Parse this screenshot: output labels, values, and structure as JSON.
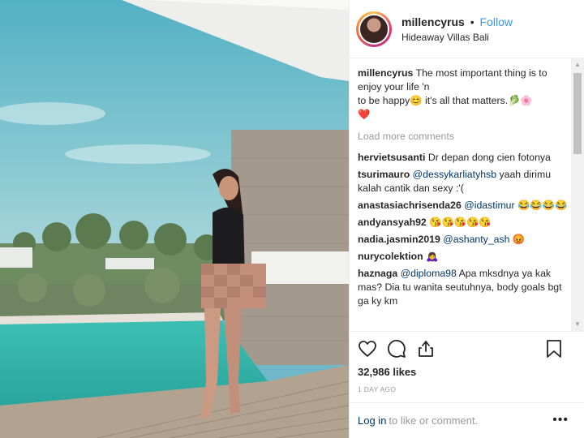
{
  "post": {
    "username": "millencyrus",
    "separator": "•",
    "follow_label": "Follow",
    "location": "Hideaway Villas Bali"
  },
  "caption": {
    "username": "millencyrus",
    "line1": "The most important thing is to enjoy your life 'n",
    "line2": "to be happy😊 it's all that matters.🥬🌸",
    "line3": "❤️"
  },
  "load_more_label": "Load more comments",
  "comments": [
    {
      "username": "hervietsusanti",
      "mention": "",
      "text": "Dr depan dong cien fotonya"
    },
    {
      "username": "tsurimauro",
      "mention": "@dessykarliatyhsb",
      "text": "yaah dirimu kalah cantik dan sexy :'("
    },
    {
      "username": "anastasiachrisenda26",
      "mention": "@idastimur",
      "text": "😂😂😂😂"
    },
    {
      "username": "andyansyah92",
      "mention": "",
      "text": "😘😘😘😘😘"
    },
    {
      "username": "nadia.jasmin2019",
      "mention": "@ashanty_ash",
      "text": "😡"
    },
    {
      "username": "nurycolektion",
      "mention": "",
      "text": "🙇‍♀️"
    },
    {
      "username": "haznaga",
      "mention": "@diploma98",
      "text": "Apa mksdnya ya kak mas? Dia tu wanita seutuhnya, body goals bgt ga ky km"
    }
  ],
  "likes": "32,986 likes",
  "date": "1 DAY AGO",
  "login": {
    "link": "Log in",
    "text": "to like or comment."
  },
  "more_options": "•••",
  "scroll": {
    "up": "▲",
    "down": "▼"
  },
  "icons": {
    "like": "heart-icon",
    "comment": "comment-bubble-icon",
    "share": "share-icon",
    "save": "bookmark-icon"
  },
  "colors": {
    "follow": "#3897f0",
    "mention": "#003569",
    "muted": "#999999",
    "text": "#262626"
  }
}
